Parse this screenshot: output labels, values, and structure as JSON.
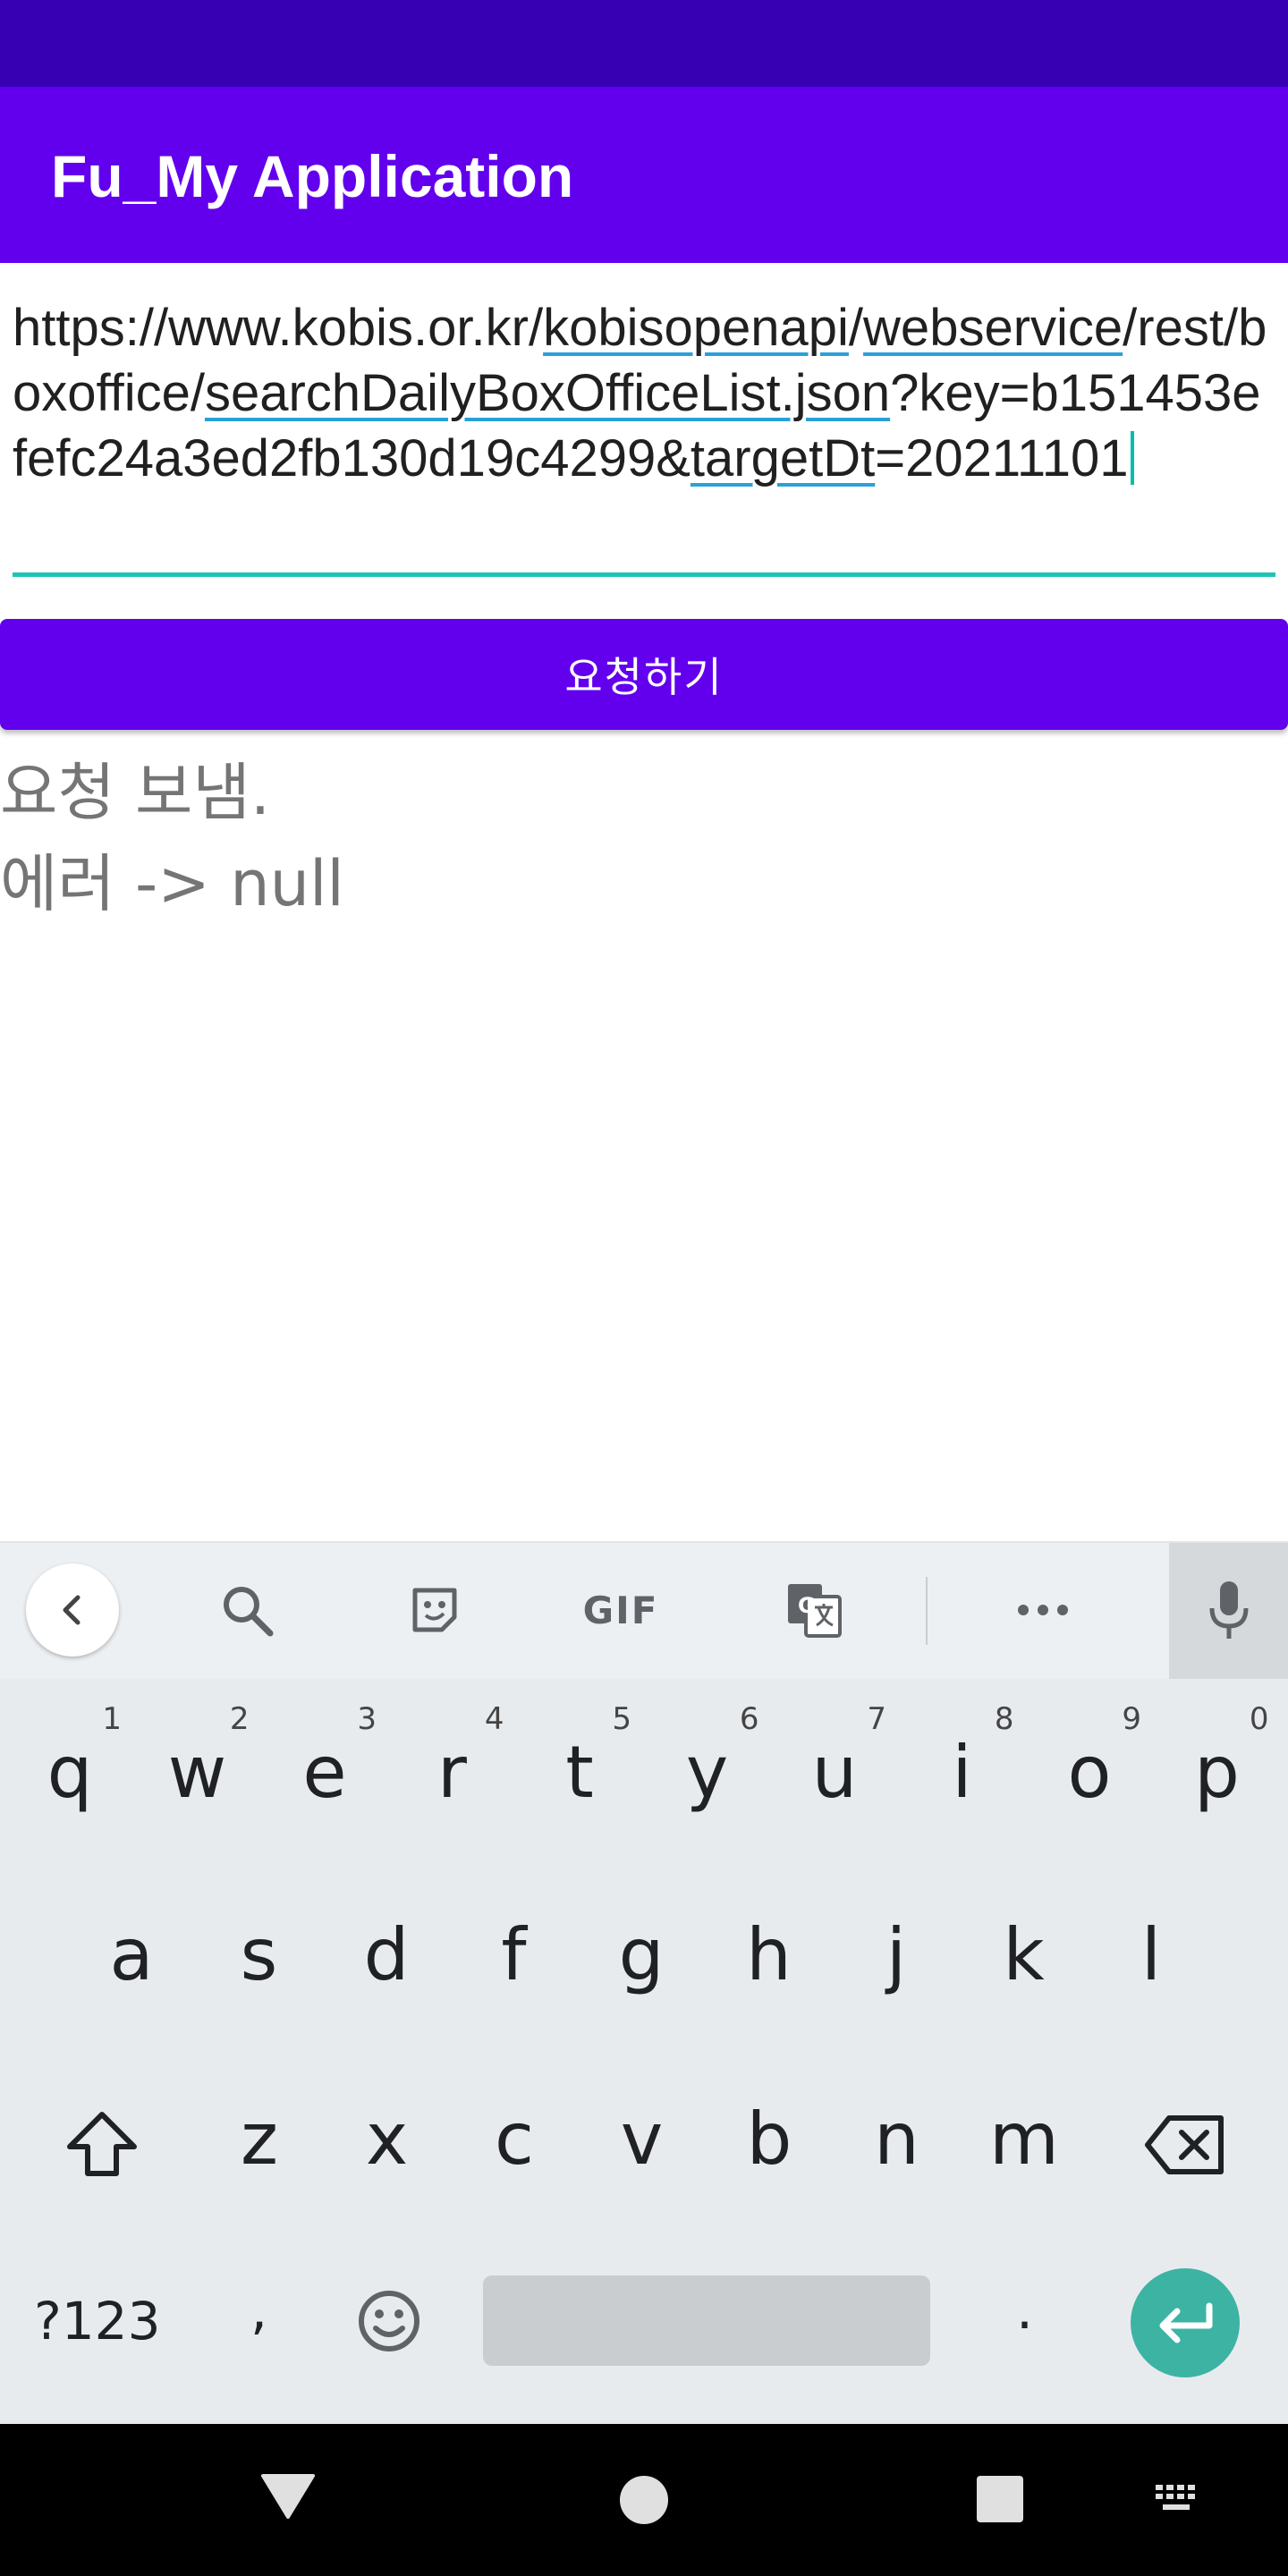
{
  "app": {
    "title": "Fu_My Application"
  },
  "url_input": {
    "segments": [
      {
        "text": "https://www.kobis.or.kr/",
        "underline": false
      },
      {
        "text": "kobisopenapi",
        "underline": true
      },
      {
        "text": "/",
        "underline": false
      },
      {
        "text": "webservice",
        "underline": true
      },
      {
        "text": "/rest/boxoffice/",
        "underline": false
      },
      {
        "text": "searchDailyBoxOfficeList.json",
        "underline": true
      },
      {
        "text": "?key=b151453efefc24a3ed2fb130d19c4299&",
        "underline": false
      },
      {
        "text": "targetDt",
        "underline": true
      },
      {
        "text": "=20211101",
        "underline": false
      }
    ]
  },
  "request_button": {
    "label": "요청하기"
  },
  "output": {
    "line1": "요청 보냄.",
    "line2": "에러 -> null"
  },
  "keyboard": {
    "toolbar": {
      "gif_label": "GIF"
    },
    "row1": [
      {
        "key": "q",
        "hint": "1"
      },
      {
        "key": "w",
        "hint": "2"
      },
      {
        "key": "e",
        "hint": "3"
      },
      {
        "key": "r",
        "hint": "4"
      },
      {
        "key": "t",
        "hint": "5"
      },
      {
        "key": "y",
        "hint": "6"
      },
      {
        "key": "u",
        "hint": "7"
      },
      {
        "key": "i",
        "hint": "8"
      },
      {
        "key": "o",
        "hint": "9"
      },
      {
        "key": "p",
        "hint": "0"
      }
    ],
    "row2": [
      "a",
      "s",
      "d",
      "f",
      "g",
      "h",
      "j",
      "k",
      "l"
    ],
    "row3": [
      "z",
      "x",
      "c",
      "v",
      "b",
      "n",
      "m"
    ],
    "symbols_label": "?123",
    "comma_label": ",",
    "period_label": "."
  },
  "colors": {
    "status_bar": "#3700b3",
    "primary": "#6200ee",
    "accent": "#1fc4b4",
    "enter": "#3db3a3"
  },
  "icons": [
    "back-chevron-icon",
    "search-icon",
    "sticker-icon",
    "translate-icon",
    "more-icon",
    "mic-icon",
    "shift-icon",
    "backspace-icon",
    "emoji-icon",
    "enter-icon",
    "nav-back-icon",
    "nav-home-icon",
    "nav-recents-icon",
    "keyboard-switch-icon"
  ]
}
